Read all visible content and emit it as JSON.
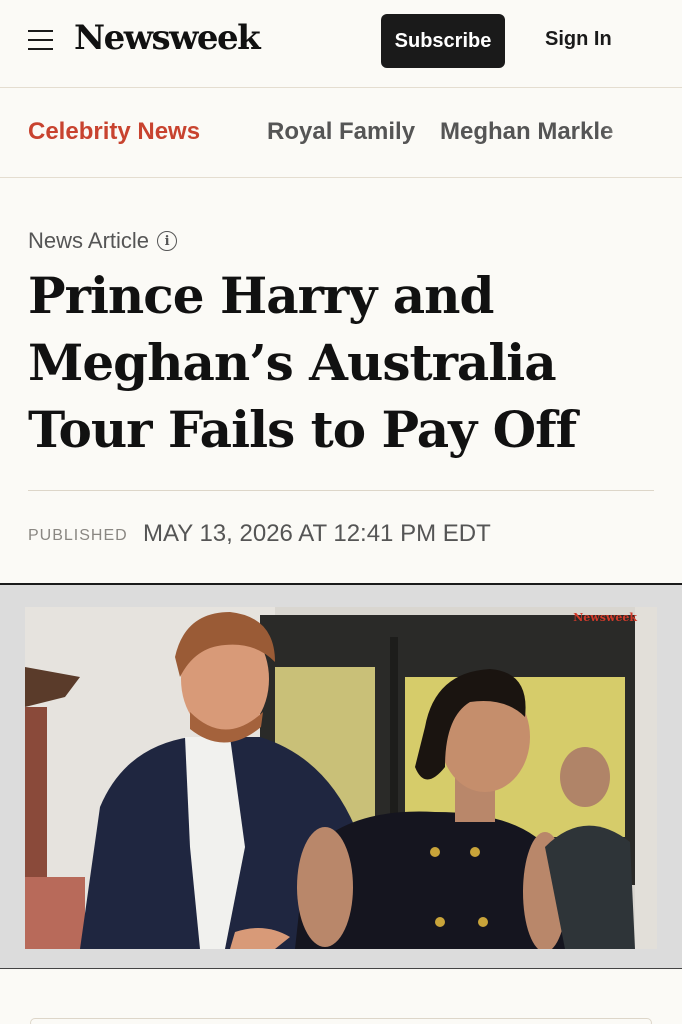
{
  "header": {
    "logo": "Newsweek",
    "subscribe_label": "Subscribe",
    "signin_label": "Sign In"
  },
  "category_nav": {
    "items": [
      "Celebrity News",
      "Royal Family",
      "Meghan Markle"
    ],
    "active": "Celebrity News"
  },
  "article": {
    "type_label": "News Article",
    "headline": "Prince Harry and Meghan’s Australia Tour Fails to Pay Off",
    "published_label": "PUBLISHED",
    "published_date": "MAY 13, 2026 AT 12:41 PM EDT"
  },
  "media": {
    "watermark": "Newsweek"
  },
  "colors": {
    "accent": "#c8432f",
    "background": "#fbfaf6",
    "button_dark": "#1a1a1a"
  }
}
